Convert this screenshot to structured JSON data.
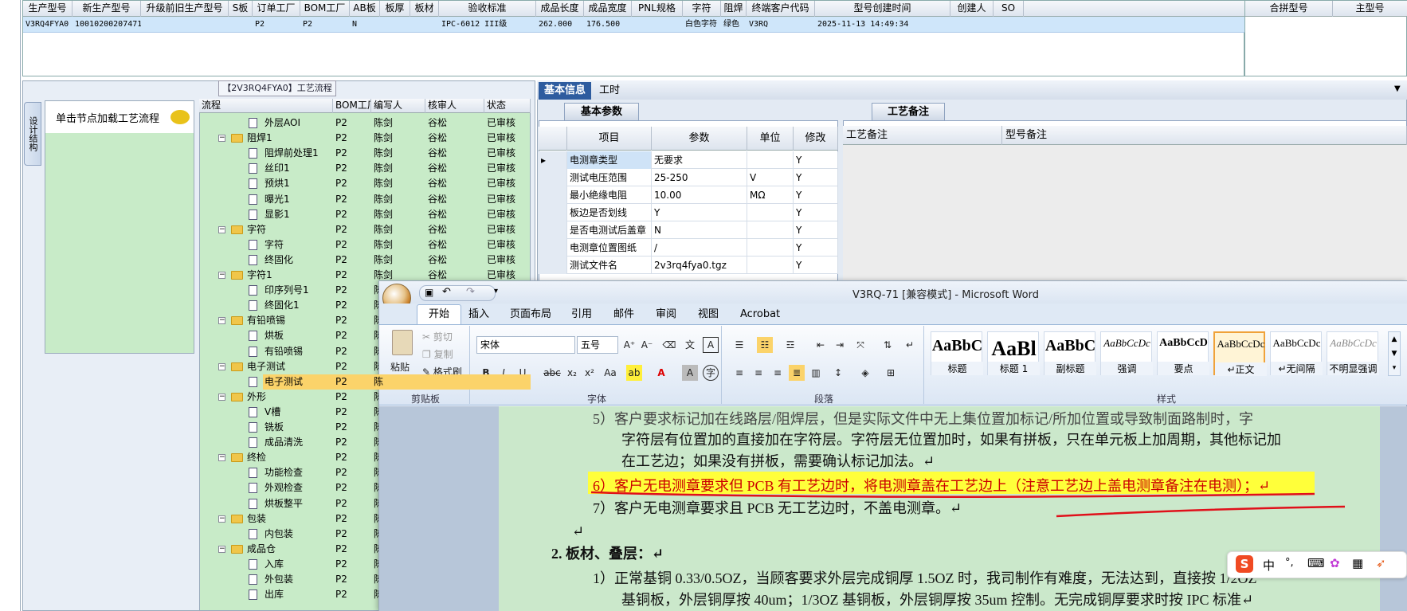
{
  "top_grid": {
    "headers": [
      "生产型号",
      "新生产型号",
      "升级前旧生产型号",
      "S板",
      "订单工厂",
      "BOM工厂",
      "AB板",
      "板厚",
      "板材",
      "验收标准",
      "成品长度",
      "成品宽度",
      "PNL规格",
      "字符",
      "阻焊",
      "终端客户代码",
      "型号创建时间",
      "创建人",
      "SO"
    ],
    "row": [
      "V3RQ4FYA0",
      "10010200207471",
      "",
      "",
      "P2",
      "P2",
      "N",
      "",
      "",
      "IPC-6012 III级",
      "262.000",
      "176.500",
      "",
      "白色字符",
      "绿色",
      "V3RQ",
      "2025-11-13 14:49:34",
      "",
      ""
    ]
  },
  "right_box": {
    "headers": [
      "合拼型号",
      "主型号"
    ]
  },
  "left_panel": {
    "vertical_tab": "设计结构",
    "node_label": "单击节点加载工艺流程",
    "process_title": "【2V3RQ4FYA0】工艺流程"
  },
  "tree": {
    "headers": [
      "流程",
      "BOM工厂",
      "编写人",
      "核审人",
      "状态"
    ],
    "rows": [
      {
        "level": 2,
        "kind": "doc",
        "name": "外层AOI",
        "factory": "P2",
        "writer": "陈剑",
        "checker": "谷松",
        "status": "已审核"
      },
      {
        "level": 1,
        "kind": "folder",
        "name": "阻焊1",
        "factory": "P2",
        "writer": "陈剑",
        "checker": "谷松",
        "status": "已审核"
      },
      {
        "level": 2,
        "kind": "doc",
        "name": "阻焊前处理1",
        "factory": "P2",
        "writer": "陈剑",
        "checker": "谷松",
        "status": "已审核"
      },
      {
        "level": 2,
        "kind": "doc",
        "name": "丝印1",
        "factory": "P2",
        "writer": "陈剑",
        "checker": "谷松",
        "status": "已审核"
      },
      {
        "level": 2,
        "kind": "doc",
        "name": "预烘1",
        "factory": "P2",
        "writer": "陈剑",
        "checker": "谷松",
        "status": "已审核"
      },
      {
        "level": 2,
        "kind": "doc",
        "name": "曝光1",
        "factory": "P2",
        "writer": "陈剑",
        "checker": "谷松",
        "status": "已审核"
      },
      {
        "level": 2,
        "kind": "doc",
        "name": "显影1",
        "factory": "P2",
        "writer": "陈剑",
        "checker": "谷松",
        "status": "已审核"
      },
      {
        "level": 1,
        "kind": "folder",
        "name": "字符",
        "factory": "P2",
        "writer": "陈剑",
        "checker": "谷松",
        "status": "已审核"
      },
      {
        "level": 2,
        "kind": "doc",
        "name": "字符",
        "factory": "P2",
        "writer": "陈剑",
        "checker": "谷松",
        "status": "已审核"
      },
      {
        "level": 2,
        "kind": "doc",
        "name": "终固化",
        "factory": "P2",
        "writer": "陈剑",
        "checker": "谷松",
        "status": "已审核"
      },
      {
        "level": 1,
        "kind": "folder",
        "name": "字符1",
        "factory": "P2",
        "writer": "陈剑",
        "checker": "谷松",
        "status": "已审核"
      },
      {
        "level": 2,
        "kind": "doc",
        "name": "印序列号1",
        "factory": "P2",
        "writer": "陈",
        "checker": "",
        "status": ""
      },
      {
        "level": 2,
        "kind": "doc",
        "name": "终固化1",
        "factory": "P2",
        "writer": "陈",
        "checker": "",
        "status": ""
      },
      {
        "level": 1,
        "kind": "folder",
        "name": "有铅喷锡",
        "factory": "P2",
        "writer": "陈",
        "checker": "",
        "status": ""
      },
      {
        "level": 2,
        "kind": "doc",
        "name": "烘板",
        "factory": "P2",
        "writer": "陈",
        "checker": "",
        "status": ""
      },
      {
        "level": 2,
        "kind": "doc",
        "name": "有铅喷锡",
        "factory": "P2",
        "writer": "陈",
        "checker": "",
        "status": ""
      },
      {
        "level": 1,
        "kind": "folder",
        "name": "电子测试",
        "factory": "P2",
        "writer": "陈",
        "checker": "",
        "status": ""
      },
      {
        "level": 2,
        "kind": "doc",
        "name": "电子测试",
        "factory": "P2",
        "writer": "陈",
        "checker": "",
        "status": "",
        "selected": true
      },
      {
        "level": 1,
        "kind": "folder",
        "name": "外形",
        "factory": "P2",
        "writer": "陈",
        "checker": "",
        "status": ""
      },
      {
        "level": 2,
        "kind": "doc",
        "name": "V槽",
        "factory": "P2",
        "writer": "陈",
        "checker": "",
        "status": ""
      },
      {
        "level": 2,
        "kind": "doc",
        "name": "铣板",
        "factory": "P2",
        "writer": "陈",
        "checker": "",
        "status": ""
      },
      {
        "level": 2,
        "kind": "doc",
        "name": "成品清洗",
        "factory": "P2",
        "writer": "陈",
        "checker": "",
        "status": ""
      },
      {
        "level": 1,
        "kind": "folder",
        "name": "终检",
        "factory": "P2",
        "writer": "陈",
        "checker": "",
        "status": ""
      },
      {
        "level": 2,
        "kind": "doc",
        "name": "功能检查",
        "factory": "P2",
        "writer": "陈",
        "checker": "",
        "status": ""
      },
      {
        "level": 2,
        "kind": "doc",
        "name": "外观检查",
        "factory": "P2",
        "writer": "陈",
        "checker": "",
        "status": ""
      },
      {
        "level": 2,
        "kind": "doc",
        "name": "烘板整平",
        "factory": "P2",
        "writer": "陈",
        "checker": "",
        "status": ""
      },
      {
        "level": 1,
        "kind": "folder",
        "name": "包装",
        "factory": "P2",
        "writer": "陈",
        "checker": "",
        "status": ""
      },
      {
        "level": 2,
        "kind": "doc",
        "name": "内包装",
        "factory": "P2",
        "writer": "陈",
        "checker": "",
        "status": ""
      },
      {
        "level": 1,
        "kind": "folder",
        "name": "成品仓",
        "factory": "P2",
        "writer": "陈",
        "checker": "",
        "status": ""
      },
      {
        "level": 2,
        "kind": "doc",
        "name": "入库",
        "factory": "P2",
        "writer": "陈",
        "checker": "",
        "status": ""
      },
      {
        "level": 2,
        "kind": "doc",
        "name": "外包装",
        "factory": "P2",
        "writer": "陈",
        "checker": "",
        "status": ""
      },
      {
        "level": 2,
        "kind": "doc",
        "name": "出库",
        "factory": "P2",
        "writer": "陈",
        "checker": "",
        "status": ""
      }
    ]
  },
  "basic_info": {
    "tabs": [
      "基本信息",
      "工时"
    ],
    "subtab_params": "基本参数",
    "subtab_notes": "工艺备注",
    "param_headers": [
      "项目",
      "参数",
      "单位",
      "修改"
    ],
    "params": [
      {
        "item": "电测章类型",
        "value": "无要求",
        "unit": "",
        "mod": "Y"
      },
      {
        "item": "测试电压范围",
        "value": "25-250",
        "unit": "V",
        "mod": "Y"
      },
      {
        "item": "最小绝缘电阻",
        "value": "10.00",
        "unit": "MΩ",
        "mod": "Y"
      },
      {
        "item": "板边是否划线",
        "value": "Y",
        "unit": "",
        "mod": "Y"
      },
      {
        "item": "是否电测试后盖章",
        "value": "N",
        "unit": "",
        "mod": "Y"
      },
      {
        "item": "电测章位置图纸",
        "value": "/",
        "unit": "",
        "mod": "Y"
      },
      {
        "item": "测试文件名",
        "value": "2v3rq4fya0.tgz",
        "unit": "",
        "mod": "Y"
      }
    ],
    "note_headers": [
      "工艺备注",
      "型号备注"
    ]
  },
  "word": {
    "title": "V3RQ-71 [兼容模式] - Microsoft Word",
    "tabs": [
      "开始",
      "插入",
      "页面布局",
      "引用",
      "邮件",
      "审阅",
      "视图",
      "Acrobat"
    ],
    "clipboard": {
      "paste": "粘贴",
      "cut": "剪切",
      "copy": "复制",
      "format_painter": "格式刷",
      "label": "剪贴板"
    },
    "font": {
      "name": "宋体",
      "size": "五号",
      "label": "字体"
    },
    "paragraph_label": "段落",
    "styles_label": "样式",
    "styles": [
      {
        "preview": "AaBbC",
        "name": "标题"
      },
      {
        "preview": "AaBl",
        "name": "标题 1"
      },
      {
        "preview": "AaBbC",
        "name": "副标题"
      },
      {
        "preview": "AaBbCcDc",
        "name": "强调"
      },
      {
        "preview": "AaBbCcD",
        "name": "要点"
      },
      {
        "preview": "AaBbCcDc",
        "name": "↵正文"
      },
      {
        "preview": "AaBbCcDc",
        "name": "↵无间隔"
      },
      {
        "preview": "AaBbCcDc",
        "name": "不明显强调"
      }
    ],
    "doc_lines": [
      "5）客户要求标记加在线路层/阻焊层，但是实际文件中无上集位置加标记/所加位置或导致制面路制时，字",
      "字符层有位置加的直接加在字符层。字符层无位置加时，如果有拼板，只在单元板上加周期，其他标记加",
      "在工艺边；如果没有拼板，需要确认标记加法。↵",
      "6）客户无电测章要求但 PCB 有工艺边时，将电测章盖在工艺边上（注意工艺边上盖电测章备注在电测）；↵",
      "7）客户无电测章要求且 PCB 无工艺边时，不盖电测章。↵",
      "↵",
      "2.   板材、叠层：↵",
      "1）正常基铜 0.33/0.5OZ，当顾客要求外层完成铜厚 1.5OZ 时，我司制作有难度，无法达到，直接按 1/2OZ",
      "基铜板，外层铜厚按 40um；1/3OZ 基铜板，外层铜厚按 35um 控制。无完成铜厚要求时按 IPC 标准↵"
    ],
    "ime": [
      "中",
      "°,",
      "⌨",
      "✿",
      "▦",
      "➶"
    ]
  }
}
